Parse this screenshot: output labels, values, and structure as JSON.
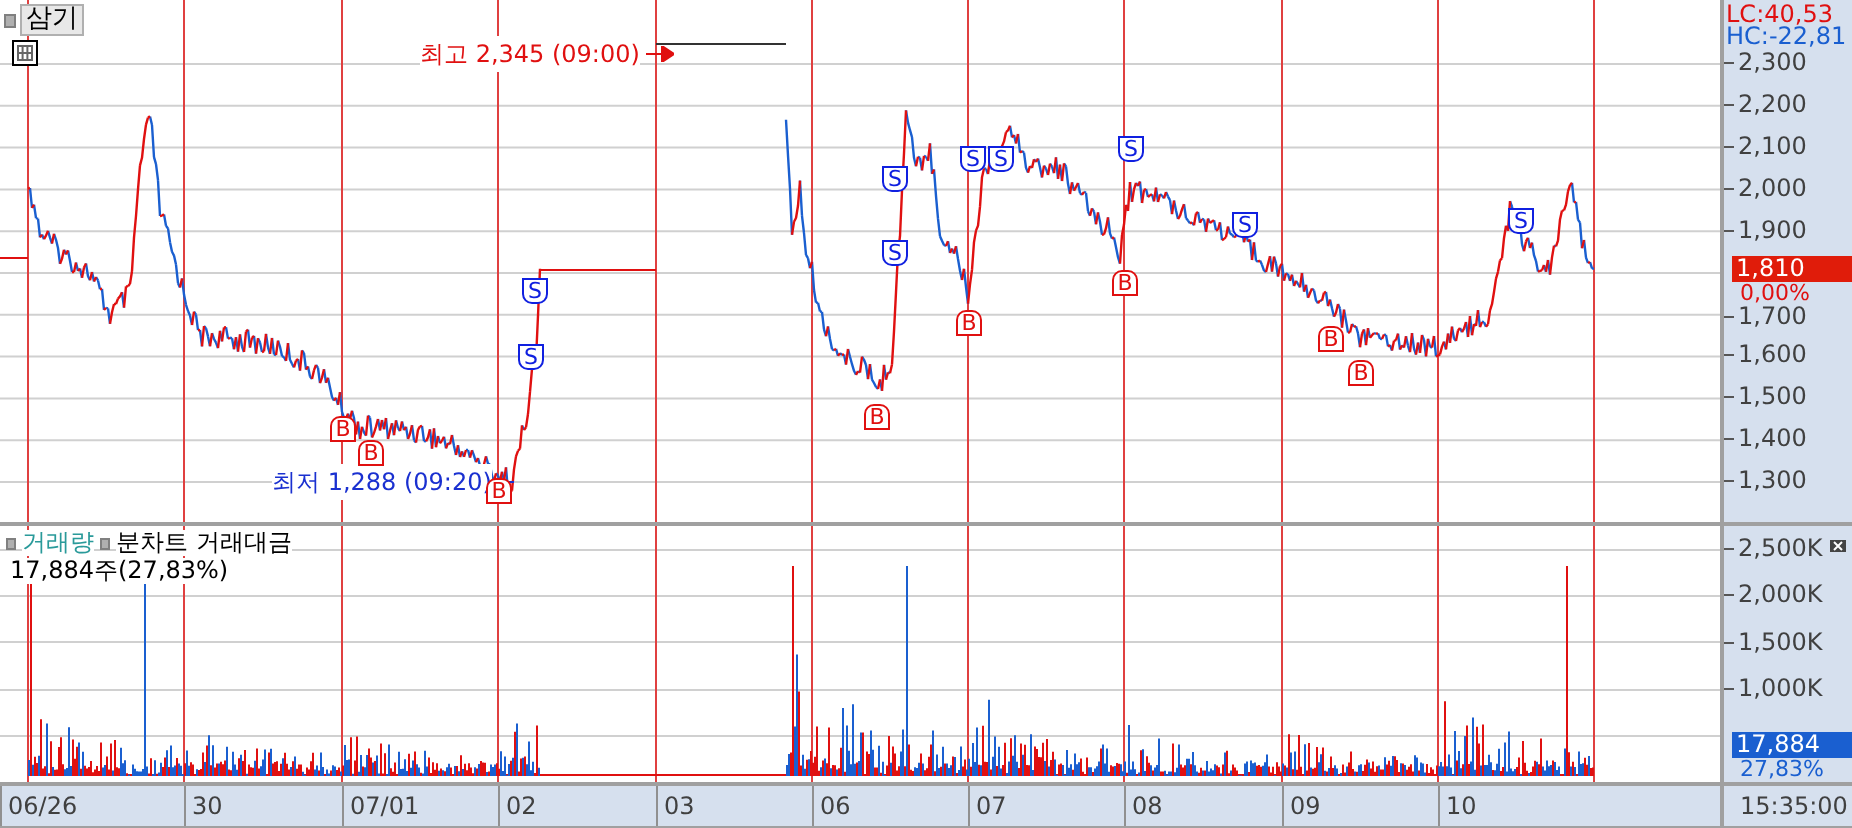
{
  "symbol": "삼기",
  "price_panel": {
    "annotations": [
      {
        "kind": "high",
        "text": "최고 2,345 (09:00)"
      },
      {
        "kind": "low",
        "text": "최저 1,288 (09:20)"
      }
    ],
    "signals": [
      {
        "kind": "buy",
        "label": "B"
      },
      {
        "kind": "buy",
        "label": "B"
      },
      {
        "kind": "buy",
        "label": "B"
      },
      {
        "kind": "sell",
        "label": "S"
      },
      {
        "kind": "sell",
        "label": "S"
      },
      {
        "kind": "sell",
        "label": "S"
      },
      {
        "kind": "sell",
        "label": "S"
      },
      {
        "kind": "buy",
        "label": "B"
      },
      {
        "kind": "buy",
        "label": "B"
      },
      {
        "kind": "sell",
        "label": "S"
      },
      {
        "kind": "sell",
        "label": "S"
      },
      {
        "kind": "buy",
        "label": "B"
      },
      {
        "kind": "sell",
        "label": "S"
      },
      {
        "kind": "sell",
        "label": "S"
      },
      {
        "kind": "buy",
        "label": "B"
      },
      {
        "kind": "buy",
        "label": "B"
      },
      {
        "kind": "sell",
        "label": "S"
      }
    ],
    "lc": "LC:40,53",
    "hc": "HC:-22,81",
    "axis_ticks": [
      "2,300",
      "2,200",
      "2,100",
      "2,000",
      "1,900",
      "1,700",
      "1,600",
      "1,500",
      "1,400",
      "1,300"
    ],
    "current_price": "1,810",
    "change": "0,00%"
  },
  "volume_panel": {
    "legend": [
      {
        "label": "거래량",
        "selected": true
      },
      {
        "label": "분차트 거래대금",
        "selected": false
      }
    ],
    "summary": "17,884주(27,83%)",
    "axis_ticks": [
      "2,500K",
      "2,000K",
      "1,500K",
      "1,000K"
    ],
    "current_volume": "17,884",
    "ratio": "27,83%"
  },
  "x_axis": {
    "dates": [
      "06/26",
      "30",
      "07/01",
      "02",
      "03",
      "06",
      "07",
      "08",
      "09",
      "10"
    ],
    "time": "15:35:00"
  }
}
